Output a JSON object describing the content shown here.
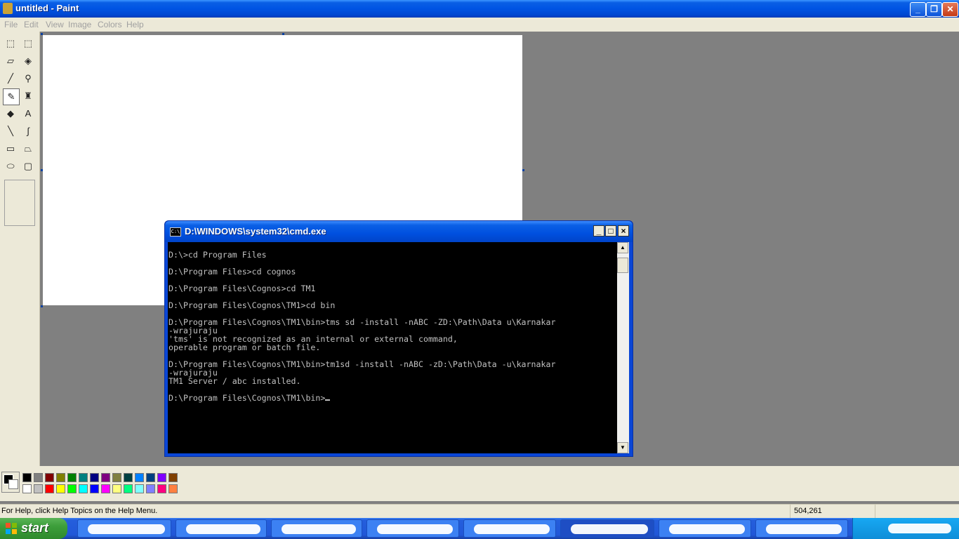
{
  "paint": {
    "title": "untitled - Paint",
    "menu": [
      "File",
      "Edit",
      "View",
      "Image",
      "Colors",
      "Help"
    ],
    "tools": [
      {
        "name": "free-form-select-icon",
        "glyph": "⬚"
      },
      {
        "name": "rect-select-icon",
        "glyph": "⬚"
      },
      {
        "name": "eraser-icon",
        "glyph": "▱"
      },
      {
        "name": "fill-bucket-icon",
        "glyph": "◈"
      },
      {
        "name": "color-picker-icon",
        "glyph": "╱"
      },
      {
        "name": "magnifier-icon",
        "glyph": "⚲"
      },
      {
        "name": "pencil-icon",
        "glyph": "✎"
      },
      {
        "name": "brush-icon",
        "glyph": "♜"
      },
      {
        "name": "airbrush-icon",
        "glyph": "◆"
      },
      {
        "name": "text-icon",
        "glyph": "A"
      },
      {
        "name": "line-icon",
        "glyph": "╲"
      },
      {
        "name": "curve-icon",
        "glyph": "∫"
      },
      {
        "name": "rectangle-icon",
        "glyph": "▭"
      },
      {
        "name": "polygon-icon",
        "glyph": "⏢"
      },
      {
        "name": "ellipse-icon",
        "glyph": "⬭"
      },
      {
        "name": "rounded-rect-icon",
        "glyph": "▢"
      }
    ],
    "palette_top": [
      "#000000",
      "#808080",
      "#800000",
      "#808000",
      "#008000",
      "#008080",
      "#000080",
      "#800080",
      "#808040",
      "#004040",
      "#0080ff",
      "#004080",
      "#8000ff",
      "#804000"
    ],
    "palette_bottom": [
      "#ffffff",
      "#c0c0c0",
      "#ff0000",
      "#ffff00",
      "#00ff00",
      "#00ffff",
      "#0000ff",
      "#ff00ff",
      "#ffff80",
      "#00ff80",
      "#80ffff",
      "#8080ff",
      "#ff0080",
      "#ff8040"
    ],
    "status_help": "For Help, click Help Topics on the Help Menu.",
    "status_coords": "504,261"
  },
  "cmd": {
    "title": "D:\\WINDOWS\\system32\\cmd.exe",
    "min_label": "_",
    "max_label": "□",
    "close_label": "×",
    "lines": [
      "D:\\>cd Program Files",
      "",
      "D:\\Program Files>cd cognos",
      "",
      "D:\\Program Files\\Cognos>cd TM1",
      "",
      "D:\\Program Files\\Cognos\\TM1>cd bin",
      "",
      "D:\\Program Files\\Cognos\\TM1\\bin>tms sd -install -nABC -ZD:\\Path\\Data u\\Karnakar",
      "-wrajuraju",
      "'tms' is not recognized as an internal or external command,",
      "operable program or batch file.",
      "",
      "D:\\Program Files\\Cognos\\TM1\\bin>tm1sd -install -nABC -zD:\\Path\\Data -u\\karnakar",
      "-wrajuraju",
      "TM1 Server / abc installed.",
      "",
      "D:\\Program Files\\Cognos\\TM1\\bin>"
    ]
  },
  "taskbar": {
    "start_label": "start"
  }
}
